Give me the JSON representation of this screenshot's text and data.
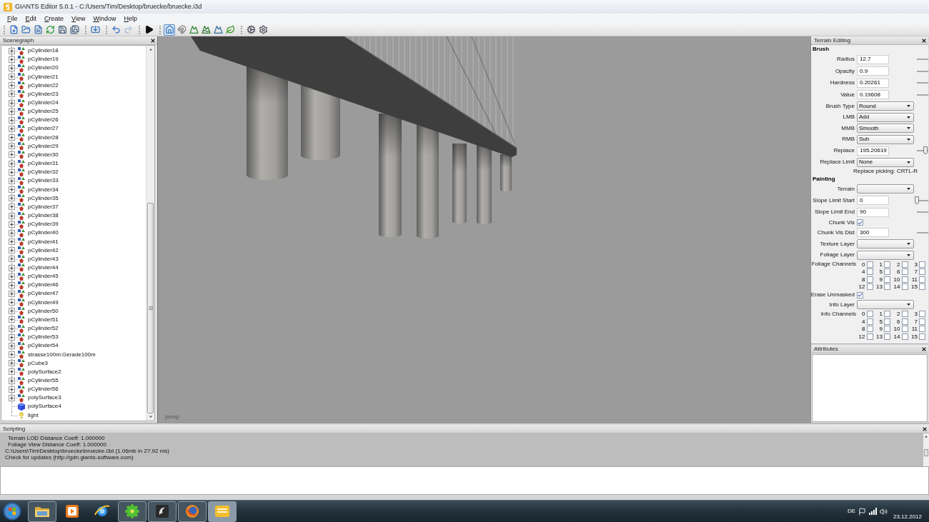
{
  "window": {
    "title": "GIANTS Editor 5.0.1 - C:/Users/Tim/Desktop/bruecke/bruecke.i3d"
  },
  "menu": [
    "File",
    "Edit",
    "Create",
    "View",
    "Window",
    "Help"
  ],
  "toolbar": [
    [
      {
        "kind": "new",
        "selected": false,
        "disabled": false
      },
      {
        "kind": "open",
        "selected": false,
        "disabled": false
      },
      {
        "kind": "list",
        "selected": false,
        "disabled": false
      },
      {
        "kind": "reload",
        "selected": false,
        "disabled": false
      },
      {
        "kind": "save",
        "selected": false,
        "disabled": false
      },
      {
        "kind": "save-as",
        "selected": false,
        "disabled": false
      }
    ],
    [
      {
        "kind": "import",
        "selected": false,
        "disabled": false
      }
    ],
    [
      {
        "kind": "undo",
        "selected": false,
        "disabled": false
      },
      {
        "kind": "redo",
        "selected": false,
        "disabled": true
      }
    ],
    [
      {
        "kind": "play",
        "selected": false,
        "disabled": false
      }
    ],
    [
      {
        "kind": "select",
        "selected": true,
        "disabled": false
      },
      {
        "kind": "magnet",
        "selected": false,
        "disabled": false
      },
      {
        "kind": "terrain-raise",
        "selected": false,
        "disabled": false
      },
      {
        "kind": "terrain-smooth",
        "selected": false,
        "disabled": false
      },
      {
        "kind": "terrain-paint",
        "selected": false,
        "disabled": false
      },
      {
        "kind": "foliage",
        "selected": false,
        "disabled": false
      }
    ],
    [
      {
        "kind": "settings",
        "selected": false,
        "disabled": false
      },
      {
        "kind": "settings-alt",
        "selected": false,
        "disabled": false
      }
    ]
  ],
  "scenegraph": {
    "title": "Scenegraph",
    "items": [
      {
        "name": "pCylinder18",
        "kind": "transform",
        "expanded": false,
        "selected": false
      },
      {
        "name": "pCylinder19",
        "kind": "transform",
        "expanded": false,
        "selected": false
      },
      {
        "name": "pCylinder20",
        "kind": "transform",
        "expanded": false,
        "selected": false
      },
      {
        "name": "pCylinder21",
        "kind": "transform",
        "expanded": false,
        "selected": false
      },
      {
        "name": "pCylinder22",
        "kind": "transform",
        "expanded": false,
        "selected": false
      },
      {
        "name": "pCylinder23",
        "kind": "transform",
        "expanded": false,
        "selected": false
      },
      {
        "name": "pCylinder24",
        "kind": "transform",
        "expanded": false,
        "selected": false
      },
      {
        "name": "pCylinder25",
        "kind": "transform",
        "expanded": false,
        "selected": false
      },
      {
        "name": "pCylinder26",
        "kind": "transform",
        "expanded": false,
        "selected": false
      },
      {
        "name": "pCylinder27",
        "kind": "transform",
        "expanded": false,
        "selected": false
      },
      {
        "name": "pCylinder28",
        "kind": "transform",
        "expanded": false,
        "selected": false
      },
      {
        "name": "pCylinder29",
        "kind": "transform",
        "expanded": false,
        "selected": false
      },
      {
        "name": "pCylinder30",
        "kind": "transform",
        "expanded": false,
        "selected": false
      },
      {
        "name": "pCylinder31",
        "kind": "transform",
        "expanded": false,
        "selected": false
      },
      {
        "name": "pCylinder32",
        "kind": "transform",
        "expanded": false,
        "selected": false
      },
      {
        "name": "pCylinder33",
        "kind": "transform",
        "expanded": false,
        "selected": false
      },
      {
        "name": "pCylinder34",
        "kind": "transform",
        "expanded": false,
        "selected": false
      },
      {
        "name": "pCylinder35",
        "kind": "transform",
        "expanded": false,
        "selected": false
      },
      {
        "name": "pCylinder37",
        "kind": "transform",
        "expanded": false,
        "selected": false
      },
      {
        "name": "pCylinder38",
        "kind": "transform",
        "expanded": false,
        "selected": false
      },
      {
        "name": "pCylinder39",
        "kind": "transform",
        "expanded": false,
        "selected": false
      },
      {
        "name": "pCylinder40",
        "kind": "transform",
        "expanded": false,
        "selected": false
      },
      {
        "name": "pCylinder41",
        "kind": "transform",
        "expanded": false,
        "selected": false
      },
      {
        "name": "pCylinder42",
        "kind": "transform",
        "expanded": false,
        "selected": false
      },
      {
        "name": "pCylinder43",
        "kind": "transform",
        "expanded": false,
        "selected": false
      },
      {
        "name": "pCylinder44",
        "kind": "transform",
        "expanded": false,
        "selected": false
      },
      {
        "name": "pCylinder45",
        "kind": "transform",
        "expanded": false,
        "selected": false
      },
      {
        "name": "pCylinder46",
        "kind": "transform",
        "expanded": false,
        "selected": false
      },
      {
        "name": "pCylinder47",
        "kind": "transform",
        "expanded": false,
        "selected": false
      },
      {
        "name": "pCylinder49",
        "kind": "transform",
        "expanded": false,
        "selected": false
      },
      {
        "name": "pCylinder50",
        "kind": "transform",
        "expanded": false,
        "selected": false
      },
      {
        "name": "pCylinder51",
        "kind": "transform",
        "expanded": false,
        "selected": false
      },
      {
        "name": "pCylinder52",
        "kind": "transform",
        "expanded": false,
        "selected": false
      },
      {
        "name": "pCylinder53",
        "kind": "transform",
        "expanded": false,
        "selected": false
      },
      {
        "name": "pCylinder54",
        "kind": "transform",
        "expanded": false,
        "selected": false
      },
      {
        "name": "strasse100m:Gerade100m",
        "kind": "transform",
        "expanded": false,
        "selected": false
      },
      {
        "name": "pCube3",
        "kind": "transform",
        "expanded": false,
        "selected": false
      },
      {
        "name": "polySurface2",
        "kind": "transform",
        "expanded": false,
        "selected": false
      },
      {
        "name": "pCylinder55",
        "kind": "transform",
        "expanded": false,
        "selected": false
      },
      {
        "name": "pCylinder56",
        "kind": "transform",
        "expanded": false,
        "selected": false
      },
      {
        "name": "polySurface3",
        "kind": "transform",
        "expanded": false,
        "selected": false
      },
      {
        "name": "polySurface4",
        "kind": "shape",
        "selected": false
      },
      {
        "name": "light",
        "kind": "light",
        "selected": false
      }
    ]
  },
  "viewport": {
    "camera": "persp"
  },
  "terrain_editing": {
    "title": "Terrain Editing",
    "sections": [
      {
        "title": "Brush",
        "rows": [
          {
            "kind": "text",
            "label": "Radius",
            "value": "12.7",
            "slider": true
          },
          {
            "kind": "text",
            "label": "Opacity",
            "value": "0.9",
            "slider": true
          },
          {
            "kind": "text",
            "label": "Hardness",
            "value": "0.20261",
            "slider": true
          },
          {
            "kind": "text",
            "label": "Value",
            "value": "0.19608",
            "slider": true
          },
          {
            "kind": "select",
            "label": "Brush Type",
            "value": "Round"
          },
          {
            "kind": "select",
            "label": "LMB",
            "value": "Add"
          },
          {
            "kind": "select",
            "label": "MMB",
            "value": "Smooth"
          },
          {
            "kind": "select",
            "label": "RMB",
            "value": "Sub"
          },
          {
            "kind": "text",
            "label": "Replace",
            "value": "195.20619",
            "slider": true,
            "level": 0.75
          },
          {
            "kind": "select",
            "label": "Replace Limit",
            "value": "None"
          },
          {
            "kind": "note",
            "text": "Replace picking: CRTL-R"
          }
        ]
      },
      {
        "title": "Painting",
        "rows": [
          {
            "kind": "select",
            "label": "Terrain"
          },
          {
            "kind": "text",
            "label": "Slope Limit Start",
            "value": "0",
            "slider": true,
            "level": 0
          },
          {
            "kind": "text",
            "label": "Slope Limit End",
            "value": "90",
            "slider": true
          },
          {
            "kind": "checkbox",
            "label": "Chunk Vis",
            "checked": true
          },
          {
            "kind": "text",
            "label": "Chunk Vis Dist",
            "value": "300",
            "slider": true
          },
          {
            "kind": "select",
            "label": "Texture Layer"
          },
          {
            "kind": "select",
            "label": "Foliage Layer"
          },
          {
            "kind": "channels",
            "label": "Foliage Channels",
            "channels": [
              {
                "label": "0",
                "checked": false
              },
              {
                "label": "1",
                "checked": false
              },
              {
                "label": "2",
                "checked": false
              },
              {
                "label": "3",
                "checked": false
              },
              {
                "label": "4",
                "checked": false
              },
              {
                "label": "5",
                "checked": false
              },
              {
                "label": "6",
                "checked": false
              },
              {
                "label": "7",
                "checked": false
              },
              {
                "label": "8",
                "checked": false
              },
              {
                "label": "9",
                "checked": false
              },
              {
                "label": "10",
                "checked": false
              },
              {
                "label": "11",
                "checked": false
              },
              {
                "label": "12",
                "checked": false
              },
              {
                "label": "13",
                "checked": false
              },
              {
                "label": "14",
                "checked": false
              },
              {
                "label": "15",
                "checked": false
              }
            ]
          },
          {
            "kind": "checkbox",
            "label": "Erase Unmasked",
            "checked": true
          },
          {
            "kind": "select",
            "label": "Info Layer"
          },
          {
            "kind": "channels",
            "label": "Info Channels",
            "channels": [
              {
                "label": "0",
                "checked": false
              },
              {
                "label": "1",
                "checked": false
              },
              {
                "label": "2",
                "checked": false
              },
              {
                "label": "3",
                "checked": false
              },
              {
                "label": "4",
                "checked": false
              },
              {
                "label": "5",
                "checked": false
              },
              {
                "label": "6",
                "checked": false
              },
              {
                "label": "7",
                "checked": false
              },
              {
                "label": "8",
                "checked": false
              },
              {
                "label": "9",
                "checked": false
              },
              {
                "label": "10",
                "checked": false
              },
              {
                "label": "11",
                "checked": false
              },
              {
                "label": "12",
                "checked": false
              },
              {
                "label": "13",
                "checked": false
              },
              {
                "label": "14",
                "checked": false
              },
              {
                "label": "15",
                "checked": false
              }
            ]
          }
        ]
      }
    ]
  },
  "attributes": {
    "title": "Attributes"
  },
  "scripting": {
    "title": "Scripting",
    "log": [
      {
        "text": "Terrain LOD Distance Coeff: 1.000000",
        "indented": true
      },
      {
        "text": "Foliage View Distance Coeff: 1.000000",
        "indented": true
      },
      {
        "text": "C:\\Users\\Tim\\Desktop\\bruecke\\bruecke.i3d (1.06mb in 27.92 ms)",
        "indented": false
      },
      {
        "text": "Check for updates (http://gdn.giants-software.com)",
        "indented": false
      }
    ]
  },
  "taskbar": {
    "apps": [
      {
        "kind": "folder",
        "running": true,
        "selected": false
      },
      {
        "kind": "media",
        "running": false,
        "selected": false
      },
      {
        "kind": "ring-globe",
        "running": false,
        "selected": false
      },
      {
        "kind": "flower",
        "running": true,
        "selected": false
      },
      {
        "kind": "swirl",
        "running": true,
        "selected": false
      },
      {
        "kind": "fox-globe",
        "running": true,
        "selected": false
      },
      {
        "kind": "notepad",
        "running": true,
        "selected": true
      }
    ],
    "language": "DE",
    "date": "23.12.2012"
  }
}
